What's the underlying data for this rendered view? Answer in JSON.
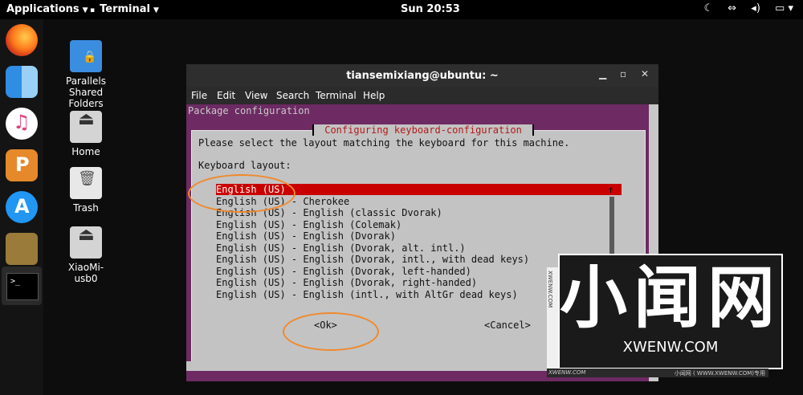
{
  "topbar": {
    "applications": "Applications",
    "terminal": "Terminal",
    "clock": "Sun 20:53",
    "tray_icons": [
      "moon-icon",
      "network-icon",
      "volume-icon",
      "battery-icon"
    ]
  },
  "dock": {
    "items": [
      "firefox",
      "finder",
      "itunes",
      "pages",
      "app-store",
      "installer",
      "terminal"
    ]
  },
  "desktop": {
    "icons": [
      {
        "label": "Parallels\nShared\nFolders"
      },
      {
        "label": "Home"
      },
      {
        "label": "Trash"
      },
      {
        "label": "XiaoMi-\nusb0"
      }
    ]
  },
  "window": {
    "title": "tiansemixiang@ubuntu: ~",
    "menu": [
      "File",
      "Edit",
      "View",
      "Search",
      "Terminal",
      "Help"
    ]
  },
  "terminal": {
    "package_config": "Package configuration",
    "dialog_title": " Configuring keyboard-configuration ",
    "prompt": "Please select the layout matching the keyboard for this machine.",
    "list_label": "Keyboard layout:",
    "options": [
      "English (US)",
      "English (US) - Cherokee",
      "English (US) - English (classic Dvorak)",
      "English (US) - English (Colemak)",
      "English (US) - English (Dvorak)",
      "English (US) - English (Dvorak, alt. intl.)",
      "English (US) - English (Dvorak, intl., with dead keys)",
      "English (US) - English (Dvorak, left-handed)",
      "English (US) - English (Dvorak, right-handed)",
      "English (US) - English (intl., with AltGr dead keys)"
    ],
    "selected_index": 0,
    "ok": "<Ok>",
    "cancel": "<Cancel>",
    "scroll_up": "↑",
    "scroll_down": "↓"
  },
  "watermark": {
    "big": "小闻网",
    "url": "XWENW.COM",
    "side": "XWENW.COM",
    "bottom_left": "XWENW.COM",
    "bottom_right": "小闻网 ( WWW.XWENW.COM)专用"
  },
  "colors": {
    "terminal_bg": "#6d2a63",
    "dialog_bg": "#c3c3c3",
    "selection": "#c80000",
    "annotation": "#f0892c"
  }
}
